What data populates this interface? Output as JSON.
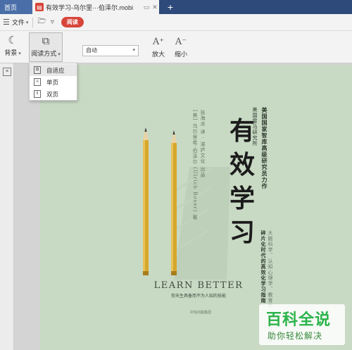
{
  "tabs": {
    "home_label": "首页",
    "doc_title": "有效学习-乌尔里···伯泽尔.mobi",
    "add_symbol": "+"
  },
  "menu": {
    "file_label": "文件",
    "read_label": "阅读"
  },
  "toolbar": {
    "background_label": "背景",
    "read_mode_label": "阅读方式",
    "zoom_value": "自动",
    "zoom_in_label": "放大",
    "zoom_out_label": "缩小"
  },
  "dropdown": {
    "items": [
      {
        "label": "自适应",
        "icon": "fit-icon"
      },
      {
        "label": "单页",
        "icon": "single-page-icon"
      },
      {
        "label": "双页",
        "icon": "double-page-icon"
      }
    ],
    "selected": "自适应"
  },
  "cover": {
    "title": "有效学习",
    "tagline": "美国国家智库高级研究员力作",
    "subtitle_cn": "美国雷马研究所",
    "authors": "[美] 乌尔里希·伯泽尔 (Ulrich Boser) 著",
    "translators": "张海龙 译 · 湛庐文化 出品",
    "slogan": "碎片化时代的高效化学习指南",
    "blurb": "大脑科学、认知心理学、教育学、行为经济学",
    "english_title": "LEARN BETTER",
    "english_sub": "你天生具备而不为人知的技能",
    "publisher": "中信出版集团"
  },
  "watermark": {
    "main": "百科全说",
    "sub": "助你轻松解决"
  },
  "colors": {
    "tabbar": "#2d4a7a",
    "accent_red": "#d7463a",
    "cover_bg": "#c8d9c4",
    "watermark_green": "#2bb34a"
  }
}
